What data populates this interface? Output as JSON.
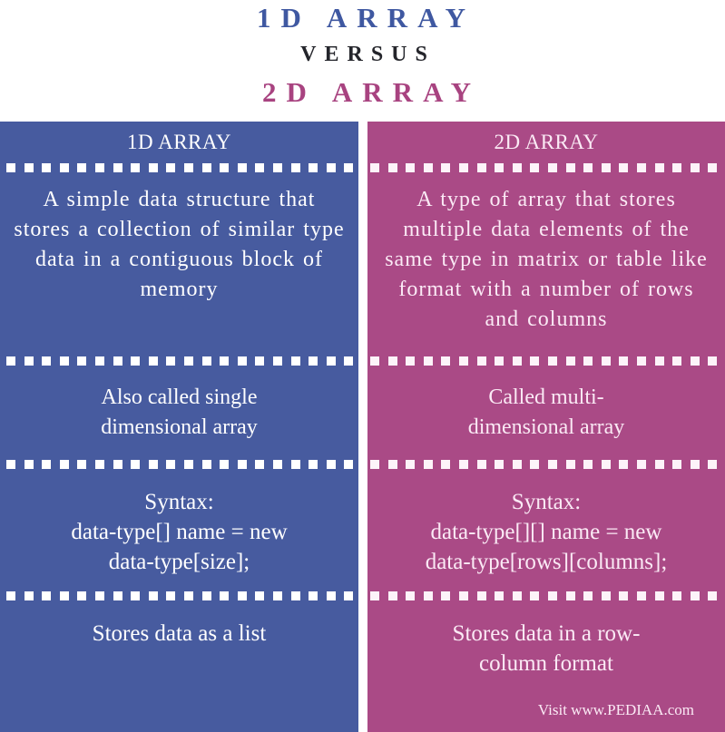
{
  "header": {
    "title_left": "1D ARRAY",
    "versus": "VERSUS",
    "title_right": "2D ARRAY"
  },
  "colors": {
    "left_panel": "#475b9f",
    "right_panel": "#aa4a86",
    "title_left": "#3f58a1",
    "title_right": "#a84380",
    "versus": "#24252b"
  },
  "columns": [
    {
      "heading": "1D ARRAY",
      "rows": [
        "A simple data structure that stores a collection of similar type data in a contiguous block of memory",
        "Also called single dimensional array",
        "Syntax:\ndata-type[] name = new\ndata-type[size];",
        "Stores data as a list"
      ]
    },
    {
      "heading": "2D ARRAY",
      "rows": [
        "A type of array that stores multiple data elements of the same type in matrix or table like format with a number of rows and columns",
        "Called multi-\ndimensional array",
        "Syntax:\ndata-type[][] name = new\ndata-type[rows][columns];",
        "Stores data in a row-\ncolumn format"
      ]
    }
  ],
  "footer": {
    "credit": "Visit www.PEDIAA.com"
  }
}
